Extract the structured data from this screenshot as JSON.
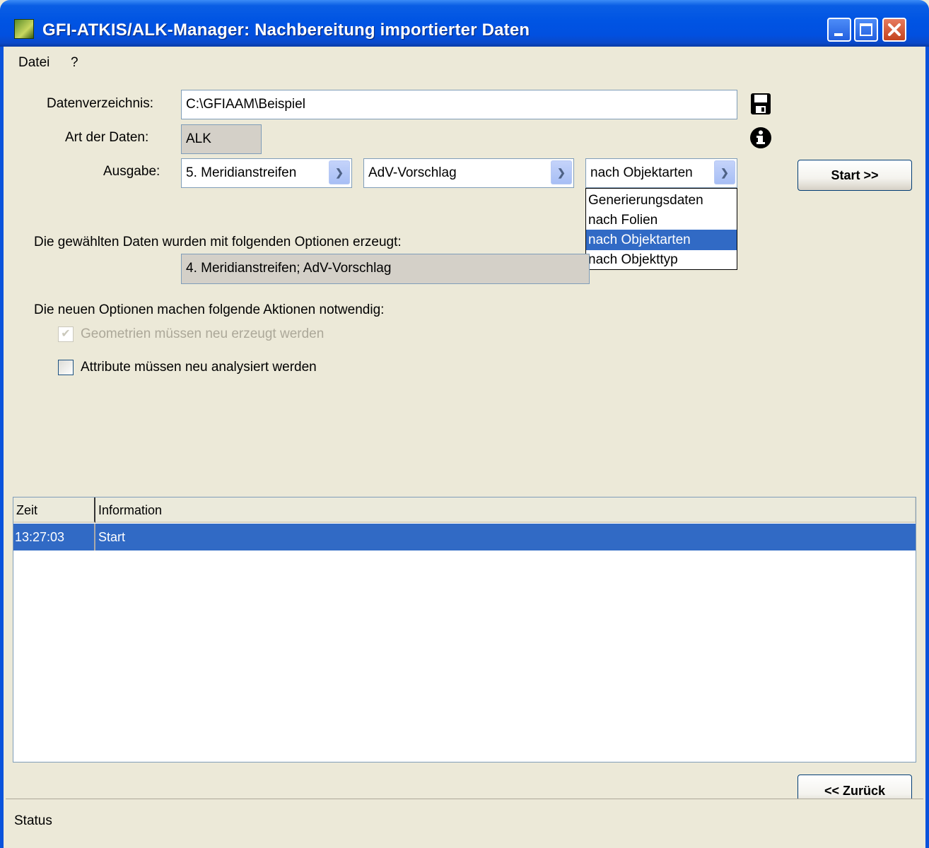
{
  "window": {
    "title": "GFI-ATKIS/ALK-Manager: Nachbereitung importierter Daten"
  },
  "menu": {
    "items": [
      "Datei",
      "?"
    ]
  },
  "form": {
    "datenverzeichnis_label": "Datenverzeichnis:",
    "datenverzeichnis_value": "C:\\GFIAAM\\Beispiel",
    "art_label": "Art der Daten:",
    "art_value": "ALK",
    "ausgabe_label": "Ausgabe:",
    "ausgabe_1": "5. Meridianstreifen",
    "ausgabe_2": "AdV-Vorschlag",
    "ausgabe_3": "nach Objektarten",
    "dropdown_options": [
      "Generierungsdaten",
      "nach Folien",
      "nach Objektarten",
      "nach Objekttyp"
    ],
    "dropdown_selected_index": 2,
    "start_button": "Start >>",
    "optionen_label": "Die gewählten Daten wurden mit folgenden Optionen erzeugt:",
    "optionen_value": "4. Meridianstreifen;   AdV-Vorschlag",
    "aktionen_label": "Die neuen Optionen machen folgende Aktionen notwendig:",
    "geometrien_label": "Geometrien müssen neu erzeugt werden",
    "geometrien_checked": true,
    "geometrien_disabled": true,
    "attribute_label": "Attribute müssen neu analysiert werden",
    "attribute_checked": false
  },
  "log": {
    "columns": [
      "Zeit",
      "Information"
    ],
    "rows": [
      {
        "zeit": "13:27:03",
        "info": "Start"
      }
    ]
  },
  "back_button": "<< Zurück",
  "status": "Status",
  "icons": {
    "save": "save-disk-icon",
    "info": "info-icon"
  },
  "colors": {
    "selection": "#316ac5",
    "titlebar": "#0054e3"
  }
}
